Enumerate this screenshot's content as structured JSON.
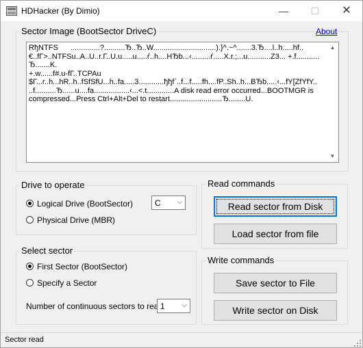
{
  "window": {
    "title": "HDHacker (By Dimio)",
    "minimize_glyph": "—",
    "maximize_glyph": "☐",
    "close_glyph": "✕",
    "icon": "app-icon"
  },
  "sector_image": {
    "title": "Sector Image (BootSector DriveC)",
    "about_label": "About",
    "content": "RђNTFS      ..............?..........Ђ..Ђ..W..............................).}^.~^.......3.Ђ....l..h.....hf..\n€..fГ>..NTFSu..A..U..r.Г..U.u.....u.....ѓ..h....HЂb...‹.........ѓ.....X.r.;...u...........Z3... +.f...........Ђ.......K.\n+.w......f#.u-fГ..TCPAu\n$Г...r..h...hR..h..fSfSfU...h..fa.....3............ђђf`..f...f.....fh....fP..Sh..h...BЂb.....‹...fY[ZfYfY..\n..f..........Ђ......u....fa.................‹...<.t.............A disk read error occurred...BOOTMGR is\ncompressed...Press Ctrl+Alt+Del to restart.........................Ђ........U."
  },
  "drive": {
    "title": "Drive to operate",
    "logical_label": "Logical Drive (BootSector)",
    "physical_label": "Physical Drive (MBR)",
    "selected": "logical",
    "drive_letter": "C"
  },
  "sector": {
    "title": "Select sector",
    "first_label": "First Sector (BootSector)",
    "specify_label": "Specify a Sector",
    "selected": "first",
    "count_label": "Number of continuous sectors to read:",
    "count_value": "1"
  },
  "read_commands": {
    "title": "Read commands",
    "read_disk_label": "Read sector from Disk",
    "load_file_label": "Load sector from file"
  },
  "write_commands": {
    "title": "Write commands",
    "save_file_label": "Save sector to File",
    "write_disk_label": "Write sector on Disk"
  },
  "status": {
    "text": "Sector read"
  }
}
